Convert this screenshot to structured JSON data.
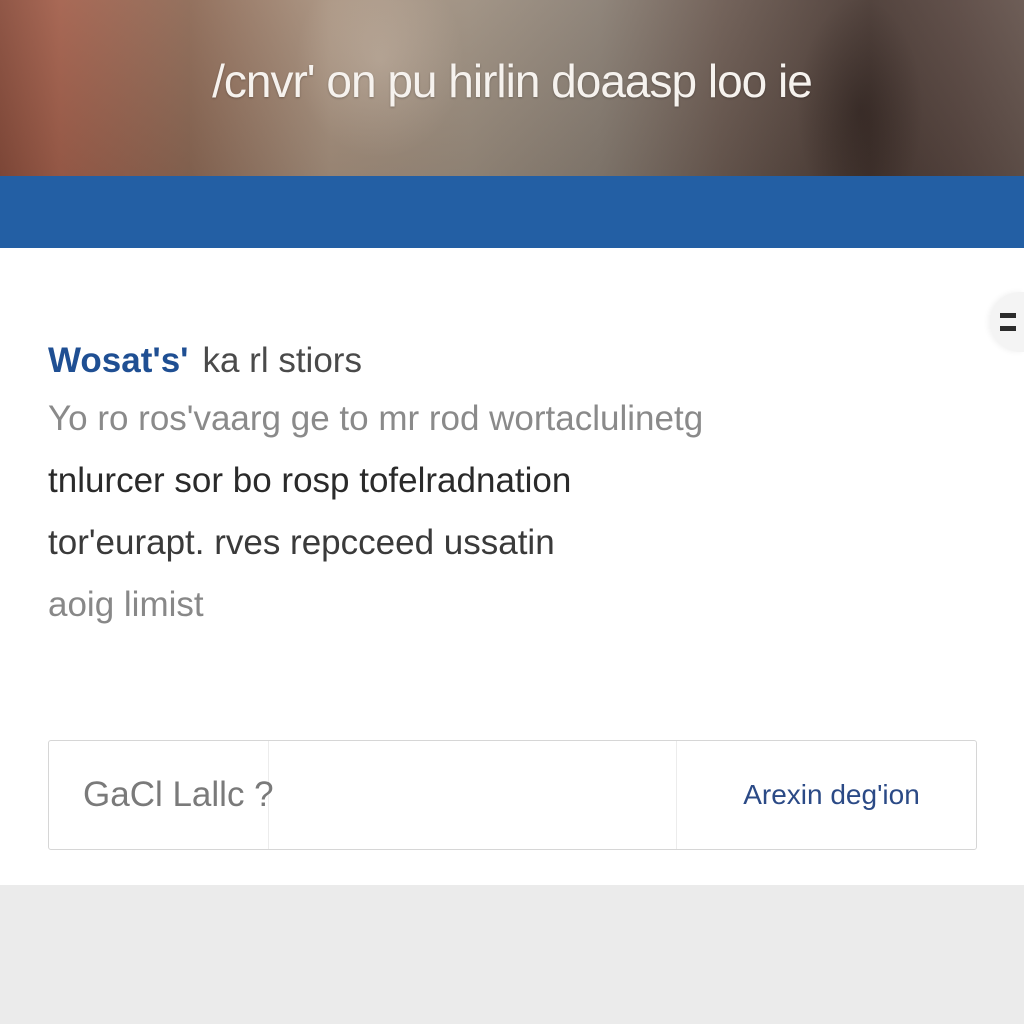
{
  "hero": {
    "title": "/cnvr' on pu hirlin doaasp loo ie"
  },
  "side_menu": {
    "icon": "menu-icon"
  },
  "intro": {
    "heading_lead": "Wosat's'",
    "heading_rest": "ka rl stiors",
    "line1": "Yo ro ros'vaarg ge to mr rod wortaclulinetg",
    "line2": "tnlurcer sor bo rosp tofelradnation",
    "line3": "tor'eurapt. rves repcceed ussatin",
    "line4": "aoig limist"
  },
  "input_bar": {
    "label": "GaCl Lallc ?",
    "value": "",
    "placeholder": "",
    "action_label": "Arexin deg'ion"
  },
  "colors": {
    "blue_band": "#235fa4",
    "heading_blue": "#1f4f93",
    "action_blue": "#2b4a86"
  }
}
